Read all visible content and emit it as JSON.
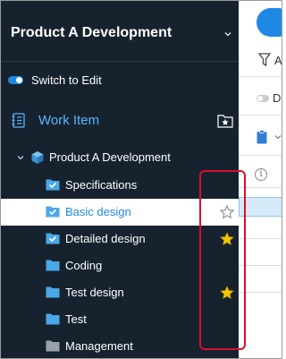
{
  "header": {
    "title": "Product A Development",
    "chevron_icon": "chevron-down-icon"
  },
  "edit_switch": {
    "label": "Switch to Edit",
    "on": true
  },
  "work_item": {
    "label": "Work Item",
    "icon": "list-icon",
    "action_icon": "starred-folder-icon"
  },
  "tree": {
    "root": {
      "label": "Product A Development",
      "icon": "cube-icon"
    },
    "items": [
      {
        "label": "Specifications",
        "icon": "folder-check-icon",
        "star": "none"
      },
      {
        "label": "Basic design",
        "icon": "folder-check-icon",
        "star": "empty",
        "selected": true
      },
      {
        "label": "Detailed design",
        "icon": "folder-check-icon",
        "star": "filled"
      },
      {
        "label": "Coding",
        "icon": "folder-icon",
        "star": "none"
      },
      {
        "label": "Test design",
        "icon": "folder-icon",
        "star": "filled"
      },
      {
        "label": "Test",
        "icon": "folder-icon",
        "star": "none"
      },
      {
        "label": "Management",
        "icon": "folder-icon",
        "star": "none",
        "muted": true
      }
    ]
  },
  "background": {
    "filter_label_fragment": "A",
    "toggle_label_fragment": "D"
  },
  "colors": {
    "sidebar_bg": "#16232f",
    "accent": "#1e88e5",
    "folder": "#4aa8e6",
    "star": "#f5c400",
    "highlight": "#d8102c"
  }
}
